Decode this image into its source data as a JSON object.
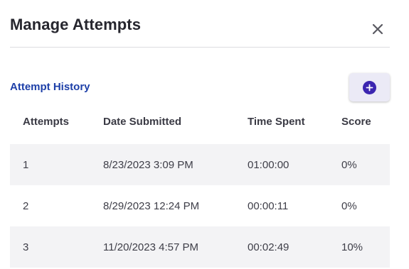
{
  "dialog": {
    "title": "Manage Attempts"
  },
  "section": {
    "title": "Attempt History",
    "add_icon": "plus-circle-icon",
    "accent_color": "#3b25b0"
  },
  "table": {
    "headers": [
      "Attempts",
      "Date Submitted",
      "Time Spent",
      "Score"
    ],
    "rows": [
      [
        "1",
        "8/23/2023 3:09 PM",
        "01:00:00",
        "0%"
      ],
      [
        "2",
        "8/29/2023 12:24 PM",
        "00:00:11",
        "0%"
      ],
      [
        "3",
        "11/20/2023 4:57 PM",
        "00:02:49",
        "10%"
      ]
    ]
  }
}
